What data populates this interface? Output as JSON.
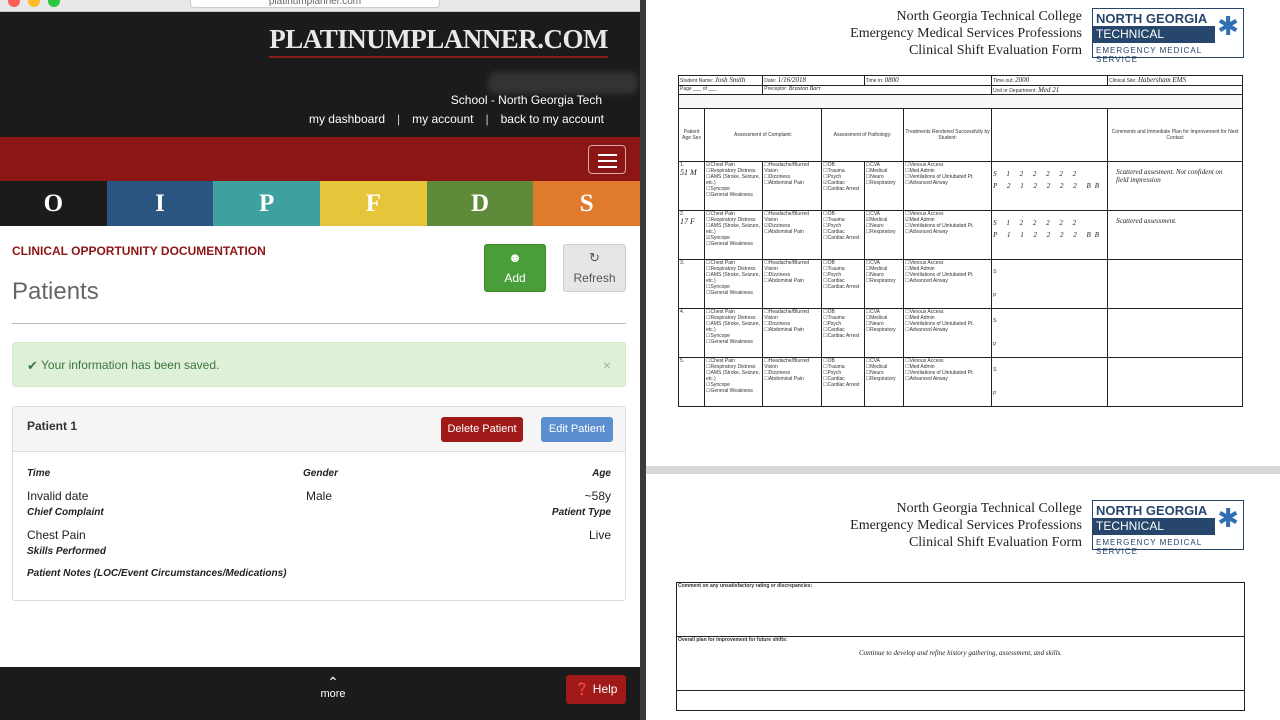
{
  "browser": {
    "url": "platinumplanner.com"
  },
  "site": {
    "logo": "PLATINUMPLANNER.COM",
    "school": "School - North Georgia Tech",
    "nav": [
      "my dashboard",
      "my account",
      "back to my account"
    ],
    "separator": "|"
  },
  "tiles": [
    {
      "letter": "O",
      "color": "#1b1b1b"
    },
    {
      "letter": "I",
      "color": "#2a5580"
    },
    {
      "letter": "P",
      "color": "#3fa0a0"
    },
    {
      "letter": "F",
      "color": "#e5c53a"
    },
    {
      "letter": "D",
      "color": "#5e8a3a"
    },
    {
      "letter": "S",
      "color": "#e07b2e"
    }
  ],
  "page": {
    "section_title": "CLINICAL OPPORTUNITY DOCUMENTATION",
    "title": "Patients",
    "add_label": "Add",
    "refresh_label": "Refresh"
  },
  "alert": {
    "message": "Your information has been saved.",
    "close": "×"
  },
  "patient": {
    "header": "Patient 1",
    "delete_label": "Delete Patient",
    "edit_label": "Edit Patient",
    "time_label": "Time",
    "gender_label": "Gender",
    "age_label": "Age",
    "time_value": "Invalid date",
    "gender_value": "Male",
    "age_value": "~58y",
    "chief_complaint_label": "Chief Complaint",
    "patient_type_label": "Patient Type",
    "chief_complaint_value": "Chest Pain",
    "patient_type_value": "Live",
    "skills_label": "Skills Performed",
    "notes_label": "Patient Notes (LOC/Event Circumstances/Medications)"
  },
  "footer": {
    "more_label": "more",
    "help_label": "Help"
  },
  "form": {
    "college": "North Georgia Technical College",
    "program": "Emergency Medical Services Professions",
    "form_title": "Clinical Shift Evaluation Form",
    "logo_line1": "NORTH GEORGIA",
    "logo_line2": "TECHNICAL COLLEGE",
    "logo_line3": "EMERGENCY MEDICAL SERVICE",
    "student_name_label": "Student Name:",
    "student_name": "Josh Smith",
    "date_label": "Date:",
    "date": "1/16/2018",
    "time_in_label": "Time in:",
    "time_in": "0800",
    "time_out_label": "Time out:",
    "time_out": "2000",
    "clinical_site_label": "Clinical Site:",
    "clinical_site": "Habersham EMS",
    "page_label": "Page ___ of ___",
    "preceptor_label": "Preceptor:",
    "preceptor": "Braxton Barr",
    "unit_label": "Unit or Department:",
    "unit": "Med 21",
    "col_patient": "Patient Age Sex",
    "col_complaint": "Assessment of Complaint:",
    "col_pathology": "Assessment of Pathology:",
    "col_treatments": "Treatments Rendered Successfully by Student:",
    "col_comments": "Comments and Immediate Plan for Improvement for Next Contact",
    "complaints": [
      "Chest Pain",
      "Respiratory Distress",
      "AMS (Stroke, Seizure, etc.)",
      "Syncope",
      "General Weakness"
    ],
    "complaints2": [
      "Headache/Blurred Vision",
      "Dizziness",
      "Abdominal Pain"
    ],
    "pathology": [
      "OB",
      "Trauma",
      "Psych",
      "Cardiac",
      "Cardiac Arrest"
    ],
    "pathology2": [
      "CVA",
      "Medical",
      "Neuro",
      "Respiratory"
    ],
    "treatments": [
      "Venous Access",
      "Med Admin",
      "Ventilations of Uintubated Pt.",
      "Advanced Airway"
    ],
    "row1_age": "51 M",
    "row2_age": "17 F",
    "row1_comment": "Scattered assesment. Not confident on field impression",
    "row2_comment": "Scattered assessment.",
    "row1_s": [
      "1",
      "2",
      "2",
      "2",
      "2",
      "2"
    ],
    "row1_p": [
      "2",
      "1",
      "2",
      "2",
      "2",
      "2"
    ],
    "row2_s": [
      "1",
      "2",
      "2",
      "2",
      "2",
      "2"
    ],
    "row2_p": [
      "1",
      "1",
      "2",
      "2",
      "2",
      "2"
    ],
    "initials": "BB",
    "comment_label": "Comment on any unsatisfactory rating or discrepancies:",
    "plan_label": "Overall plan for improvement for future shifts:",
    "plan_text": "Continue to develop and refine history gathering, assessment, and skills."
  }
}
